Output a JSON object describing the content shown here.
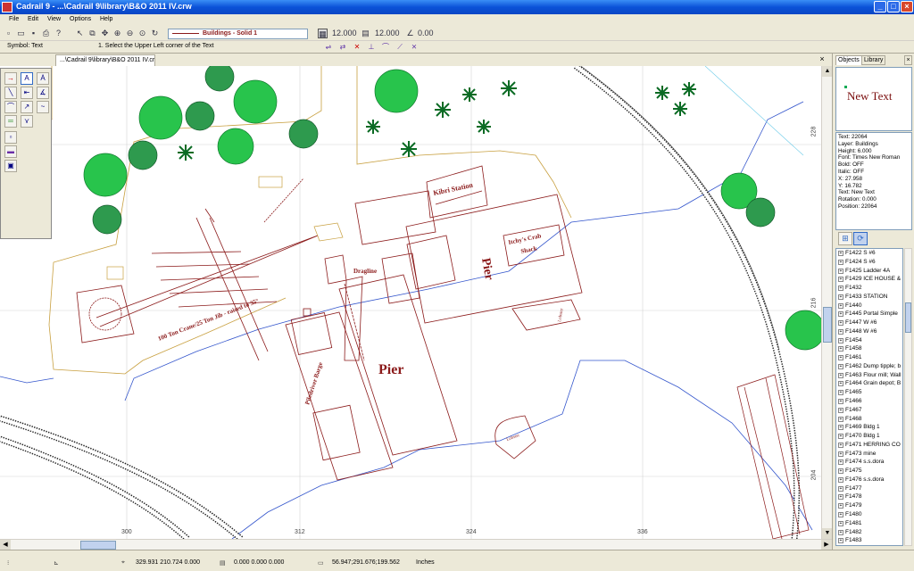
{
  "window": {
    "title": "Cadrail 9 - ...\\Cadrail 9\\library\\B&O 2011 IV.crw",
    "min_label": "_",
    "max_label": "□",
    "close_label": "×"
  },
  "menu": [
    "File",
    "Edit",
    "View",
    "Options",
    "Help"
  ],
  "toolbar": {
    "layer_combo": "Buildings - Solid 1",
    "value_a": "12.000",
    "value_b": "12.000",
    "value_c": "0.00"
  },
  "statusrow": {
    "symbol": "Symbol: Text",
    "prompt": "1. Select the Upper Left corner of the Text"
  },
  "document_tab": {
    "label": "...\\Cadrail 9\\library\\B&O 2011 IV.crw",
    "close_label": "×"
  },
  "canvas": {
    "labels": {
      "kibri": "Kibri Station",
      "itchy": "Itchy's Crab",
      "shack": "Shack",
      "pier_top": "Pier",
      "pier_bottom": "Pier",
      "dragline": "Dragline",
      "crane": "100 Ton Crane/25 Ton Jib - raised to 35°",
      "barge": "Piledriver Barge",
      "lobster1": "Lobster",
      "lobster2": "Lobster"
    },
    "ruler_x": [
      "300",
      "312",
      "324",
      "336"
    ],
    "ruler_y": [
      "228",
      "216",
      "204"
    ]
  },
  "right_panel": {
    "tabs": [
      "Objects",
      "Library"
    ],
    "preview_text": "New Text",
    "properties": [
      "Text: 22064",
      "Layer: Buildings",
      "Height: 6.000",
      "Font: Times New Roman",
      "Bold: OFF",
      "Italic: OFF",
      "X: 27.958",
      "Y: 16.782",
      "Text: New Text",
      "Rotation: 0.000",
      "Position: 22064"
    ],
    "tree_items": [
      "F1422 S #6",
      "F1424 S #6",
      "F1425 Ladder 4A",
      "F1429 ICE HOUSE &",
      "F1432",
      "F1433 STATION",
      "F1440",
      "F1445 Portal Simple",
      "F1447 W #6",
      "F1448 W #6",
      "F1454",
      "F1458",
      "F1461",
      "F1462 Dump tipple; b",
      "F1463 Flour mill; Wall",
      "F1464 Grain depot; B",
      "F1465",
      "F1466",
      "F1467",
      "F1468",
      "F1469 Bldg 1",
      "F1470 Bldg 1",
      "F1471 HERRING CO",
      "F1473 mine",
      "F1474 s.s.dora",
      "F1475",
      "F1476 s.s.dora",
      "F1477",
      "F1478",
      "F1479",
      "F1480",
      "F1481",
      "F1482",
      "F1483"
    ]
  },
  "statusbar": {
    "coords_a": "329.931  210.724  0.000",
    "coords_b": "0.000  0.000  0.000",
    "coords_c": "56.947;291.676;199.562",
    "units": "Inches"
  },
  "colors": {
    "title_bar": "#0b52d8",
    "building": "#8b1a1a",
    "tree_green": "#22c24a",
    "water": "#3355cc",
    "shore": "#c8a040",
    "grid": "#d0d0d0"
  }
}
